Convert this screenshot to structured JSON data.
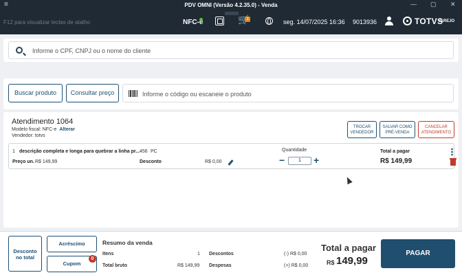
{
  "window": {
    "title": "PDV OMNI (Versão 4.2.35.0) - Venda",
    "menu_glyph": "≡",
    "controls": {
      "minimize": "—",
      "maximize": "▢",
      "close": "✕"
    }
  },
  "header": {
    "hint": "F12 para visualizar teclas de atalho",
    "nfce_label": "NFC-e",
    "cart_count": "1",
    "datetime": "seg. 14/07/2025 16:36",
    "store_code": "9013936",
    "logo_text": "TOTVS",
    "logo_sub": "VAREJO",
    "colors": {
      "background": "#1f2a35",
      "nfce_status": "#5bc236",
      "cart_badge": "#e08a1f"
    }
  },
  "client_search": {
    "placeholder": "Informe o CPF, CNPJ ou o nome do cliente"
  },
  "product": {
    "search_button": "Buscar produto",
    "price_button": "Consultar preço",
    "placeholder": "Informe o código ou escaneie o produto"
  },
  "sale": {
    "title": "Atendimento 1064",
    "fiscal_model": "Modelo fiscal: NFC-e",
    "change_label": "Alterar",
    "seller": "Vendedor: totvs",
    "actions": {
      "swap_seller": [
        "TROCAR",
        "VENDEDOR"
      ],
      "save_presale": [
        "SALVAR COMO",
        "PRÉ-VENDA"
      ],
      "cancel": [
        "CANCELAR",
        "ATENDIMENTO"
      ]
    },
    "item": {
      "index": "1",
      "description": "descrição completa e longa para quebrar a linha pr...",
      "code": "456",
      "unit": "PC",
      "unit_price_label": "Preço un.",
      "unit_price": "R$ 149,99",
      "discount_label": "Desconto",
      "discount_value": "R$ 0,00",
      "quantity_label": "Quantidade",
      "quantity": "1",
      "total_label": "Total a pagar",
      "total": "R$ 149,99"
    }
  },
  "footer": {
    "discount_button": [
      "Desconto",
      "no total"
    ],
    "surcharge_button": "Acréscimo",
    "promo_button": "Cupom Promocional",
    "promo_count": "0",
    "summary_title": "Resumo da venda",
    "items_label": "Itens",
    "items_value": "1",
    "gross_label": "Total bruto",
    "gross_value": "R$ 149,99",
    "discounts_label": "Descontos",
    "discounts_value": "(-) R$ 0,00",
    "expenses_label": "Despesas",
    "expenses_value": "(+) R$ 0,00",
    "total_label": "Total a pagar",
    "total_currency": "R$",
    "total_value": "149,99",
    "pay_button": "PAGAR",
    "colors": {
      "primary": "#1f4e6e",
      "danger": "#c0392b"
    }
  }
}
